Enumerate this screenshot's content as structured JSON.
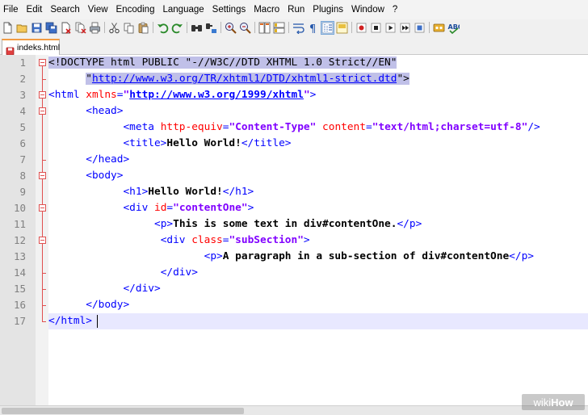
{
  "menu": [
    "File",
    "Edit",
    "Search",
    "View",
    "Encoding",
    "Language",
    "Settings",
    "Macro",
    "Run",
    "Plugins",
    "Window",
    "?"
  ],
  "toolbar_icons": [
    "new-file-icon",
    "open-file-icon",
    "save-icon",
    "save-all-icon",
    "close-icon",
    "close-all-icon",
    "print-icon",
    "|",
    "cut-icon",
    "copy-icon",
    "paste-icon",
    "|",
    "undo-icon",
    "redo-icon",
    "|",
    "find-icon",
    "replace-icon",
    "|",
    "zoom-in-icon",
    "zoom-out-icon",
    "|",
    "sync-vertical-icon",
    "sync-horizontal-icon",
    "|",
    "word-wrap-icon",
    "show-all-chars-icon",
    "indent-guide-icon",
    "doc-map-icon",
    "|",
    "record-macro-icon",
    "stop-macro-icon",
    "play-macro-icon",
    "run-macro-multiple-icon",
    "save-macro-icon",
    "|",
    "function-list-icon",
    "spell-check-icon"
  ],
  "tab": {
    "label": "indeks.html"
  },
  "code_lines": [
    {
      "n": "1",
      "fold": "open",
      "parts": [
        {
          "t": "<!DOCTYPE html PUBLIC ",
          "c": "dt sel"
        },
        {
          "t": "\"",
          "c": "dt sel"
        },
        {
          "t": "-//W3C//DTD XHTML 1.0 Strict//EN",
          "c": "dt sel"
        },
        {
          "t": "\"",
          "c": "dt sel"
        }
      ]
    },
    {
      "n": "2",
      "fold": "end",
      "parts": [
        {
          "t": "      ",
          "c": "dt"
        },
        {
          "t": "\"",
          "c": "dt sel"
        },
        {
          "t": "http://www.w3.org/TR/xhtml1/DTD/xhtml1-strict.dtd",
          "c": "url sel"
        },
        {
          "t": "\">",
          "c": "dt sel"
        }
      ]
    },
    {
      "n": "3",
      "fold": "open",
      "parts": [
        {
          "t": "<html ",
          "c": "tag"
        },
        {
          "t": "xmlns",
          "c": "attr"
        },
        {
          "t": "=",
          "c": "tag"
        },
        {
          "t": "\"",
          "c": "val"
        },
        {
          "t": "http://www.w3.org/1999/xhtml",
          "c": "val url"
        },
        {
          "t": "\"",
          "c": "val"
        },
        {
          "t": ">",
          "c": "tag"
        }
      ]
    },
    {
      "n": "4",
      "fold": "open",
      "parts": [
        {
          "t": "      ",
          "c": "dt"
        },
        {
          "t": "<head>",
          "c": "tag"
        }
      ]
    },
    {
      "n": "5",
      "fold": "line",
      "parts": [
        {
          "t": "            ",
          "c": "dt"
        },
        {
          "t": "<meta ",
          "c": "tag"
        },
        {
          "t": "http-equiv",
          "c": "attr"
        },
        {
          "t": "=",
          "c": "tag"
        },
        {
          "t": "\"Content-Type\"",
          "c": "val"
        },
        {
          "t": " content",
          "c": "attr"
        },
        {
          "t": "=",
          "c": "tag"
        },
        {
          "t": "\"text/html;charset=utf-8\"",
          "c": "val"
        },
        {
          "t": "/>",
          "c": "tag"
        }
      ]
    },
    {
      "n": "6",
      "fold": "line",
      "parts": [
        {
          "t": "            ",
          "c": "dt"
        },
        {
          "t": "<title>",
          "c": "tag"
        },
        {
          "t": "Hello World!",
          "c": "txt"
        },
        {
          "t": "</title>",
          "c": "tag"
        }
      ]
    },
    {
      "n": "7",
      "fold": "end",
      "parts": [
        {
          "t": "      ",
          "c": "dt"
        },
        {
          "t": "</head>",
          "c": "tag"
        }
      ]
    },
    {
      "n": "8",
      "fold": "open",
      "parts": [
        {
          "t": "      ",
          "c": "dt"
        },
        {
          "t": "<body>",
          "c": "tag"
        }
      ]
    },
    {
      "n": "9",
      "fold": "line",
      "parts": [
        {
          "t": "            ",
          "c": "dt"
        },
        {
          "t": "<h1>",
          "c": "tag"
        },
        {
          "t": "Hello World!",
          "c": "txt"
        },
        {
          "t": "</h1>",
          "c": "tag"
        }
      ]
    },
    {
      "n": "10",
      "fold": "open",
      "parts": [
        {
          "t": "            ",
          "c": "dt"
        },
        {
          "t": "<div ",
          "c": "tag"
        },
        {
          "t": "id",
          "c": "attr"
        },
        {
          "t": "=",
          "c": "tag"
        },
        {
          "t": "\"contentOne\"",
          "c": "val"
        },
        {
          "t": ">",
          "c": "tag"
        }
      ]
    },
    {
      "n": "11",
      "fold": "line",
      "parts": [
        {
          "t": "                 ",
          "c": "dt"
        },
        {
          "t": "<p>",
          "c": "tag"
        },
        {
          "t": "This is some text in div#contentOne.",
          "c": "txt"
        },
        {
          "t": "</p>",
          "c": "tag"
        }
      ]
    },
    {
      "n": "12",
      "fold": "open",
      "parts": [
        {
          "t": "                  ",
          "c": "dt"
        },
        {
          "t": "<div ",
          "c": "tag"
        },
        {
          "t": "class",
          "c": "attr"
        },
        {
          "t": "=",
          "c": "tag"
        },
        {
          "t": "\"subSection\"",
          "c": "val"
        },
        {
          "t": ">",
          "c": "tag"
        }
      ]
    },
    {
      "n": "13",
      "fold": "line",
      "parts": [
        {
          "t": "                         ",
          "c": "dt"
        },
        {
          "t": "<p>",
          "c": "tag"
        },
        {
          "t": "A paragraph in a sub-section of div#contentOne",
          "c": "txt"
        },
        {
          "t": "</p>",
          "c": "tag"
        }
      ]
    },
    {
      "n": "14",
      "fold": "end",
      "parts": [
        {
          "t": "                  ",
          "c": "dt"
        },
        {
          "t": "</div>",
          "c": "tag"
        }
      ]
    },
    {
      "n": "15",
      "fold": "end",
      "parts": [
        {
          "t": "            ",
          "c": "dt"
        },
        {
          "t": "</div>",
          "c": "tag"
        }
      ]
    },
    {
      "n": "16",
      "fold": "end",
      "parts": [
        {
          "t": "      ",
          "c": "dt"
        },
        {
          "t": "</body>",
          "c": "tag"
        }
      ]
    },
    {
      "n": "17",
      "fold": "end",
      "current": true,
      "parts": [
        {
          "t": "</html>",
          "c": "tag"
        }
      ]
    }
  ],
  "watermark": {
    "a": "wiki",
    "b": "How"
  },
  "colors": {
    "tag": "#0000ff",
    "attribute": "#ff0000",
    "value": "#8000ff",
    "fold_marker": "#e05050",
    "tab_accent": "#f29b43",
    "selection": "#c0c0e8",
    "current_line": "#e8e8ff"
  }
}
